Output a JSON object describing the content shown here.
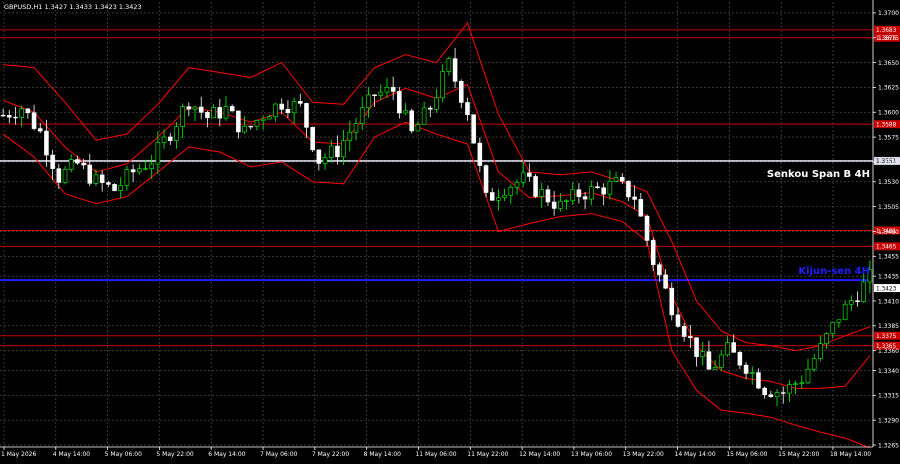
{
  "chart_data": {
    "type": "candlestick",
    "header": "GBPUSD,H1  1.3427 1.3433 1.3423 1.3423",
    "colors": {
      "background": "#000000",
      "grid": "#5a5a5a",
      "bull": "#00ff00",
      "bear": "#ffffff",
      "bands": "#ff0000",
      "level_red": "#c80000",
      "senkou": "#d8d8e8",
      "kijun": "#1f1fff",
      "price_tag": "#ffffff",
      "axis_text": "#ffffff"
    },
    "ylim": [
      1.3263,
      1.3711
    ],
    "y_ticks": [
      "1.3700",
      "1.3675",
      "1.3650",
      "1.3625",
      "1.3600",
      "1.3575",
      "1.3550",
      "1.3530",
      "1.3505",
      "1.3480",
      "1.3455",
      "1.3435",
      "1.3410",
      "1.3385",
      "1.3360",
      "1.3340",
      "1.3315",
      "1.3290",
      "1.3265"
    ],
    "x_ticks": [
      "1 May 2026",
      "4 May 14:00",
      "5 May 06:00",
      "5 May 22:00",
      "6 May 14:00",
      "7 May 06:00",
      "7 May 22:00",
      "8 May 14:00",
      "11 May 06:00",
      "11 May 22:00",
      "12 May 14:00",
      "13 May 06:00",
      "13 May 22:00",
      "14 May 14:00",
      "15 May 06:00",
      "15 May 22:00",
      "18 May 14:00"
    ],
    "levels": [
      {
        "price": 1.3683,
        "label": "1.3683",
        "kind": "red"
      },
      {
        "price": 1.3675,
        "label": "1.3675",
        "kind": "red"
      },
      {
        "price": 1.3588,
        "label": "1.3588",
        "kind": "red"
      },
      {
        "price": 1.3551,
        "label": "1.3551",
        "kind": "senkou"
      },
      {
        "price": 1.3481,
        "label": "1.3481",
        "kind": "red"
      },
      {
        "price": 1.3465,
        "label": "1.3465",
        "kind": "red"
      },
      {
        "price": 1.3431,
        "label": "",
        "kind": "kijun"
      },
      {
        "price": 1.3375,
        "label": "1.3375",
        "kind": "red"
      },
      {
        "price": 1.3365,
        "label": "1.3365",
        "kind": "red"
      }
    ],
    "current_price": "1.3423",
    "annotations": [
      {
        "text": "Senkou Span B 4H",
        "price": 1.3538,
        "color": "#ffffff"
      },
      {
        "text": "Kijun-sen 4H",
        "price": 1.344,
        "color": "#1f1fff"
      }
    ],
    "close_path": [
      [
        0,
        1.3597
      ],
      [
        3,
        1.3605
      ],
      [
        6,
        1.358
      ],
      [
        9,
        1.3535
      ],
      [
        12,
        1.3548
      ],
      [
        15,
        1.353
      ],
      [
        18,
        1.3522
      ],
      [
        21,
        1.354
      ],
      [
        24,
        1.3552
      ],
      [
        27,
        1.358
      ],
      [
        30,
        1.3612
      ],
      [
        33,
        1.3595
      ],
      [
        36,
        1.3603
      ],
      [
        39,
        1.358
      ],
      [
        42,
        1.3598
      ],
      [
        45,
        1.361
      ],
      [
        48,
        1.3605
      ],
      [
        51,
        1.3552
      ],
      [
        54,
        1.3562
      ],
      [
        57,
        1.359
      ],
      [
        60,
        1.3618
      ],
      [
        63,
        1.3622
      ],
      [
        66,
        1.3578
      ],
      [
        69,
        1.3605
      ],
      [
        72,
        1.3648
      ],
      [
        75,
        1.3602
      ],
      [
        78,
        1.3512
      ],
      [
        81,
        1.3525
      ],
      [
        84,
        1.3532
      ],
      [
        87,
        1.3518
      ],
      [
        90,
        1.3505
      ],
      [
        93,
        1.3518
      ],
      [
        96,
        1.3522
      ],
      [
        99,
        1.3528
      ],
      [
        102,
        1.3515
      ],
      [
        105,
        1.345
      ],
      [
        108,
        1.3405
      ],
      [
        111,
        1.337
      ],
      [
        114,
        1.334
      ],
      [
        117,
        1.336
      ],
      [
        120,
        1.3345
      ],
      [
        123,
        1.3322
      ],
      [
        126,
        1.3318
      ],
      [
        129,
        1.3332
      ],
      [
        132,
        1.3362
      ],
      [
        135,
        1.3395
      ],
      [
        138,
        1.3418
      ],
      [
        140,
        1.3433
      ]
    ],
    "upper_band_path": [
      [
        0,
        1.3648
      ],
      [
        5,
        1.3645
      ],
      [
        10,
        1.361
      ],
      [
        15,
        1.3572
      ],
      [
        20,
        1.3578
      ],
      [
        25,
        1.3608
      ],
      [
        30,
        1.3645
      ],
      [
        35,
        1.364
      ],
      [
        40,
        1.3635
      ],
      [
        45,
        1.365
      ],
      [
        50,
        1.361
      ],
      [
        55,
        1.3608
      ],
      [
        60,
        1.3645
      ],
      [
        65,
        1.3658
      ],
      [
        70,
        1.365
      ],
      [
        75,
        1.369
      ],
      [
        80,
        1.3598
      ],
      [
        85,
        1.354
      ],
      [
        90,
        1.3537
      ],
      [
        95,
        1.354
      ],
      [
        100,
        1.353
      ],
      [
        104,
        1.352
      ],
      [
        108,
        1.347
      ],
      [
        112,
        1.341
      ],
      [
        116,
        1.338
      ],
      [
        120,
        1.3368
      ],
      [
        124,
        1.3365
      ],
      [
        128,
        1.336
      ],
      [
        132,
        1.3365
      ],
      [
        136,
        1.3375
      ],
      [
        140,
        1.3384
      ]
    ],
    "lower_band_path": [
      [
        0,
        1.3578
      ],
      [
        5,
        1.3555
      ],
      [
        10,
        1.3518
      ],
      [
        15,
        1.3508
      ],
      [
        20,
        1.3515
      ],
      [
        25,
        1.354
      ],
      [
        30,
        1.3565
      ],
      [
        35,
        1.356
      ],
      [
        40,
        1.3545
      ],
      [
        45,
        1.355
      ],
      [
        50,
        1.353
      ],
      [
        55,
        1.3528
      ],
      [
        60,
        1.3575
      ],
      [
        65,
        1.359
      ],
      [
        70,
        1.3578
      ],
      [
        75,
        1.3568
      ],
      [
        80,
        1.348
      ],
      [
        85,
        1.3488
      ],
      [
        90,
        1.3495
      ],
      [
        95,
        1.3498
      ],
      [
        100,
        1.349
      ],
      [
        104,
        1.347
      ],
      [
        108,
        1.336
      ],
      [
        112,
        1.332
      ],
      [
        116,
        1.33
      ],
      [
        120,
        1.3297
      ],
      [
        124,
        1.3293
      ],
      [
        128,
        1.3285
      ],
      [
        132,
        1.3278
      ],
      [
        136,
        1.3272
      ],
      [
        140,
        1.3262
      ]
    ],
    "middle_band_path": [
      [
        0,
        1.3612
      ],
      [
        5,
        1.36
      ],
      [
        10,
        1.3565
      ],
      [
        15,
        1.354
      ],
      [
        20,
        1.3548
      ],
      [
        25,
        1.3575
      ],
      [
        30,
        1.3605
      ],
      [
        35,
        1.36
      ],
      [
        40,
        1.359
      ],
      [
        45,
        1.36
      ],
      [
        50,
        1.357
      ],
      [
        55,
        1.3568
      ],
      [
        60,
        1.361
      ],
      [
        65,
        1.3624
      ],
      [
        70,
        1.3614
      ],
      [
        75,
        1.3628
      ],
      [
        80,
        1.354
      ],
      [
        85,
        1.3514
      ],
      [
        90,
        1.3516
      ],
      [
        95,
        1.3519
      ],
      [
        100,
        1.351
      ],
      [
        104,
        1.3495
      ],
      [
        108,
        1.3415
      ],
      [
        112,
        1.3365
      ],
      [
        116,
        1.334
      ],
      [
        120,
        1.3332
      ],
      [
        124,
        1.3329
      ],
      [
        128,
        1.3322
      ],
      [
        132,
        1.3322
      ],
      [
        136,
        1.3324
      ],
      [
        140,
        1.3355
      ]
    ]
  }
}
